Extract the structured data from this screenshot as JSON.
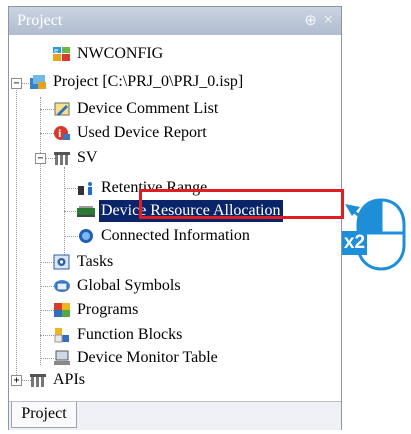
{
  "panel": {
    "title": "Project",
    "pin_icon": "pin-icon",
    "close_icon": "close-icon",
    "tab_label": "Project"
  },
  "tree": {
    "nwconfig": "NWCONFIG",
    "project": "Project [C:\\PRJ_0\\PRJ_0.isp]",
    "device_comment_list": "Device Comment List",
    "used_device_report": "Used Device Report",
    "sv": "SV",
    "retentive_range": "Retentive Range",
    "device_resource_allocation": "Device Resource Allocation",
    "connected_information": "Connected Information",
    "tasks": "Tasks",
    "global_symbols": "Global Symbols",
    "programs": "Programs",
    "function_blocks": "Function Blocks",
    "device_monitor_table": "Device Monitor Table",
    "apis": "APIs"
  },
  "expanders": {
    "project": "−",
    "sv": "−",
    "apis": "+"
  },
  "annotation": {
    "double_click_badge": "x2",
    "accent_red": "#e01d25",
    "accent_blue": "#1e8ed9"
  }
}
